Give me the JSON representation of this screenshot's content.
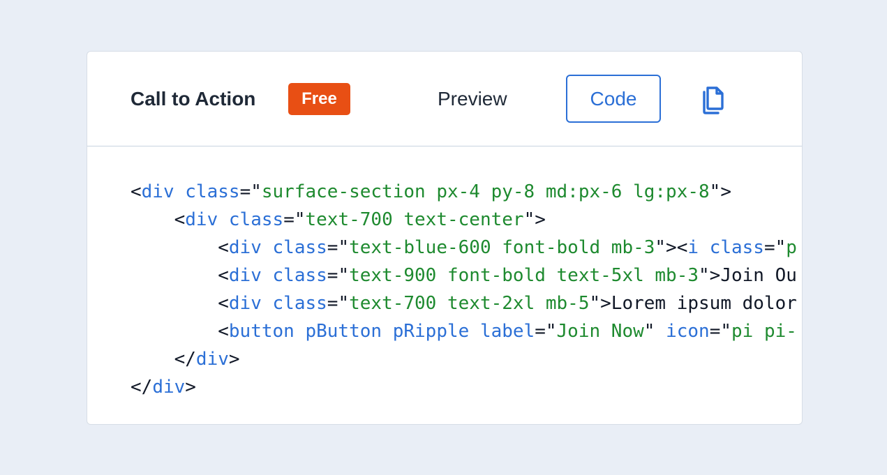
{
  "header": {
    "title": "Call to Action",
    "badge": "Free",
    "tab_preview": "Preview",
    "tab_code": "Code",
    "copy_icon": "copy-icon"
  },
  "colors": {
    "background": "#e9eef6",
    "badge": "#e84f14",
    "accent": "#2b6fd6",
    "string": "#1e8a2f"
  },
  "code": {
    "lines": [
      [
        [
          "plain",
          "<"
        ],
        [
          "tag",
          "div"
        ],
        [
          "plain",
          " "
        ],
        [
          "attr",
          "class"
        ],
        [
          "plain",
          "=\""
        ],
        [
          "str",
          "surface-section px-4 py-8 md:px-6 lg:px-8"
        ],
        [
          "plain",
          "\">"
        ]
      ],
      [
        [
          "plain",
          "    <"
        ],
        [
          "tag",
          "div"
        ],
        [
          "plain",
          " "
        ],
        [
          "attr",
          "class"
        ],
        [
          "plain",
          "=\""
        ],
        [
          "str",
          "text-700 text-center"
        ],
        [
          "plain",
          "\">"
        ]
      ],
      [
        [
          "plain",
          "        <"
        ],
        [
          "tag",
          "div"
        ],
        [
          "plain",
          " "
        ],
        [
          "attr",
          "class"
        ],
        [
          "plain",
          "=\""
        ],
        [
          "str",
          "text-blue-600 font-bold mb-3"
        ],
        [
          "plain",
          "\"><"
        ],
        [
          "tag",
          "i"
        ],
        [
          "plain",
          " "
        ],
        [
          "attr",
          "class"
        ],
        [
          "plain",
          "=\""
        ],
        [
          "str",
          "p"
        ]
      ],
      [
        [
          "plain",
          "        <"
        ],
        [
          "tag",
          "div"
        ],
        [
          "plain",
          " "
        ],
        [
          "attr",
          "class"
        ],
        [
          "plain",
          "=\""
        ],
        [
          "str",
          "text-900 font-bold text-5xl mb-3"
        ],
        [
          "plain",
          "\">Join Ou"
        ]
      ],
      [
        [
          "plain",
          "        <"
        ],
        [
          "tag",
          "div"
        ],
        [
          "plain",
          " "
        ],
        [
          "attr",
          "class"
        ],
        [
          "plain",
          "=\""
        ],
        [
          "str",
          "text-700 text-2xl mb-5"
        ],
        [
          "plain",
          "\">Lorem ipsum dolor"
        ]
      ],
      [
        [
          "plain",
          "        <"
        ],
        [
          "tag",
          "button"
        ],
        [
          "plain",
          " "
        ],
        [
          "attr",
          "pButton"
        ],
        [
          "plain",
          " "
        ],
        [
          "attr",
          "pRipple"
        ],
        [
          "plain",
          " "
        ],
        [
          "attr",
          "label"
        ],
        [
          "plain",
          "=\""
        ],
        [
          "str",
          "Join Now"
        ],
        [
          "plain",
          "\" "
        ],
        [
          "attr",
          "icon"
        ],
        [
          "plain",
          "=\""
        ],
        [
          "str",
          "pi pi-"
        ]
      ],
      [
        [
          "plain",
          "    </"
        ],
        [
          "tag",
          "div"
        ],
        [
          "plain",
          ">"
        ]
      ],
      [
        [
          "plain",
          "</"
        ],
        [
          "tag",
          "div"
        ],
        [
          "plain",
          ">"
        ]
      ]
    ]
  }
}
